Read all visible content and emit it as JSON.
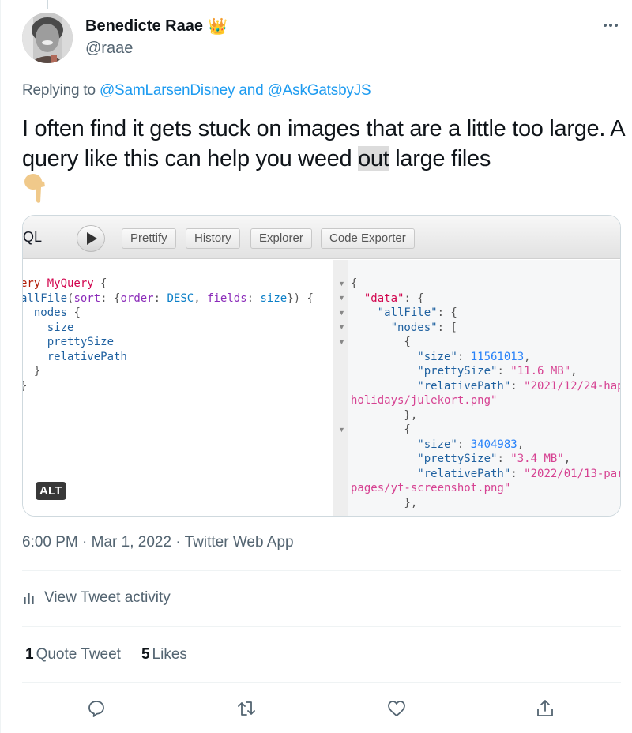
{
  "author": {
    "display_name": "Benedicte Raae",
    "name_emoji": "👑",
    "handle": "@raae"
  },
  "more_menu_icon": "ellipsis-icon",
  "reply_context": {
    "prefix": "Replying to",
    "mention_1": "@SamLarsenDisney",
    "conjunction": "and",
    "mention_2": "@AskGatsbyJS"
  },
  "tweet": {
    "text_before_highlight": "I often find it gets stuck on images that are a little too large. A query like this can help you weed ",
    "highlighted_word": "out",
    "text_after_highlight": " large files",
    "trailing_emoji": "👇"
  },
  "media": {
    "alt_badge": "ALT",
    "graphiql": {
      "title": "iQL",
      "run_icon": "play-icon",
      "buttons": [
        "Prettify",
        "History",
        "Explorer",
        "Code Exporter"
      ],
      "query_lines": [
        "ery MyQuery {",
        "allFile(sort: {order: DESC, fields: size}) {",
        "  nodes {",
        "    size",
        "    prettySize",
        "    relativePath",
        "  }",
        "}"
      ],
      "result_lines": [
        "{",
        "  \"data\": {",
        "    \"allFile\": {",
        "      \"nodes\": [",
        "        {",
        "          \"size\": 11561013,",
        "          \"prettySize\": \"11.6 MB\",",
        "          \"relativePath\": \"2021/12/24-hap",
        "holidays/julekort.png\"",
        "        },",
        "        {",
        "          \"size\": 3404983,",
        "          \"prettySize\": \"3.4 MB\",",
        "          \"relativePath\": \"2022/01/13-par",
        "pages/yt-screenshot.png\"",
        "        },"
      ],
      "nodes": [
        {
          "size": "11561013",
          "prettySize": "\"11.6 MB\"",
          "relativePath_start": "\"2021/12/24-hap",
          "relativePath_end": "holidays/julekort.png\""
        },
        {
          "size": "3404983",
          "prettySize": "\"3.4 MB\"",
          "relativePath_start": "\"2022/01/13-par",
          "relativePath_end": "pages/yt-screenshot.png\""
        }
      ]
    }
  },
  "meta": {
    "time": "6:00 PM",
    "separator": "·",
    "date": "Mar 1, 2022",
    "source": "Twitter Web App"
  },
  "activity": {
    "icon": "analytics-icon",
    "label": "View Tweet activity"
  },
  "stats": {
    "quote_count": "1",
    "quote_label": "Quote Tweet",
    "like_count": "5",
    "like_label": "Likes"
  },
  "actions": [
    "reply-icon",
    "retweet-icon",
    "like-icon",
    "share-icon"
  ]
}
